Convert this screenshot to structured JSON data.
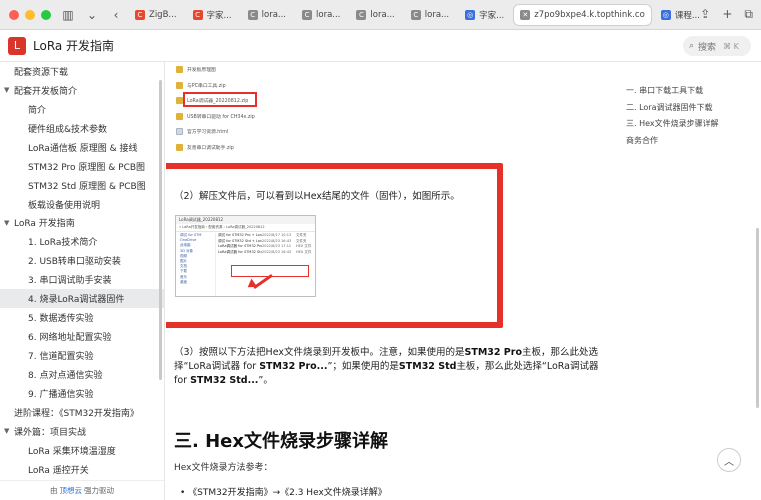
{
  "browser": {
    "tabs": [
      {
        "label": "ZigB...",
        "fav": "C",
        "color": "fav-red"
      },
      {
        "label": "字家...",
        "fav": "C",
        "color": "fav-red"
      },
      {
        "label": "lora...",
        "fav": "C",
        "color": "fav-gray"
      },
      {
        "label": "lora...",
        "fav": "C",
        "color": "fav-gray"
      },
      {
        "label": "lora...",
        "fav": "C",
        "color": "fav-gray"
      },
      {
        "label": "lora...",
        "fav": "C",
        "color": "fav-gray"
      },
      {
        "label": "字家...",
        "fav": "◎",
        "color": "fav-blue"
      },
      {
        "label": "z7po9bxpe4.k.topthink.co",
        "fav": "✕",
        "color": "fav-gray"
      },
      {
        "label": "课程...",
        "fav": "◎",
        "color": "fav-blue"
      }
    ]
  },
  "header": {
    "logo_letter": "L",
    "title": "LoRa 开发指南",
    "search_label": "搜索",
    "search_shortcut": "⌘ K"
  },
  "sidebar": {
    "items": [
      {
        "label": "配套资源下载",
        "caret": ""
      },
      {
        "label": "配套开发板简介",
        "caret": "▼"
      },
      {
        "label": "简介",
        "caret": " "
      },
      {
        "label": "硬件组成&技术参数",
        "caret": " "
      },
      {
        "label": "LoRa通信板 原理图 & 接线",
        "caret": " "
      },
      {
        "label": "STM32 Pro 原理图 & PCB图",
        "caret": " "
      },
      {
        "label": "STM32 Std 原理图 & PCB图",
        "caret": " "
      },
      {
        "label": "板载设备使用说明",
        "caret": " "
      },
      {
        "label": "LoRa 开发指南",
        "caret": "▼"
      },
      {
        "label": "1. LoRa技术简介",
        "caret": " "
      },
      {
        "label": "2. USB转串口驱动安装",
        "caret": " "
      },
      {
        "label": "3. 串口调试助手安装",
        "caret": " "
      },
      {
        "label": "4. 烧录LoRa调试器固件",
        "caret": " "
      },
      {
        "label": "5. 数据透传实验",
        "caret": " "
      },
      {
        "label": "6. 网络地址配置实验",
        "caret": " "
      },
      {
        "label": "7. 信道配置实验",
        "caret": " "
      },
      {
        "label": "8. 点对点通信实验",
        "caret": " "
      },
      {
        "label": "9. 广播通信实验",
        "caret": " "
      },
      {
        "label": "进阶课程：《STM32开发指南》",
        "caret": ""
      },
      {
        "label": "课外篇：项目实战",
        "caret": "▼"
      },
      {
        "label": "LoRa 采集环境温湿度",
        "caret": " "
      },
      {
        "label": "LoRa 遥控开关",
        "caret": " "
      }
    ],
    "footer_prefix": "由",
    "footer_brand": "顶想云",
    "footer_suffix": "强力驱动"
  },
  "content": {
    "files": [
      {
        "name": "开发板原理图",
        "kind": "fi-zip"
      },
      {
        "name": "与PC串口工具.zip",
        "kind": "fi-zip"
      },
      {
        "name": "LoRa调试器_20220812.zip",
        "kind": "fi-zip"
      },
      {
        "name": "USB转串口驱动 for CH34x.zip",
        "kind": "fi-zip"
      },
      {
        "name": "官方学习资源.html",
        "kind": "fi-doc"
      },
      {
        "name": "友善串口调试助手.zip",
        "kind": "fi-zip"
      }
    ],
    "step2": "（2）解压文件后，可以看到以Hex结尾的文件（固件），如图所示。",
    "explorer": {
      "title": "LoRa调试器_20220812",
      "address": "« LoRa开发指南 › 配套资源 › LoRa调试器_20220812",
      "nav": [
        "调试 for STM",
        "OneDrive",
        "此电脑",
        "3D 对象",
        "视频",
        "图片",
        "文档",
        "下载",
        "音乐",
        "桌面"
      ],
      "rows": [
        {
          "name": "调试 for STM32 Pro + Lora",
          "date": "2022/8/17 10:13",
          "type": "文件夹"
        },
        {
          "name": "调试 for STM32 Std + Lora",
          "date": "2022/8/23 16:43",
          "type": "文件夹"
        },
        {
          "name": "LoRa调试器 for STM32 Pro v1.2.hex",
          "date": "2022/8/23 17:11",
          "type": "HEX 文件"
        },
        {
          "name": "LoRa调试器 for STM32 Std v1.2.hex",
          "date": "2022/8/23 16:43",
          "type": "HEX 文件"
        }
      ]
    },
    "para3": {
      "p1": "（3）按照以下方法把Hex文件烧录到开发板中。注意，如果使用的是",
      "b1": "STM32 Pro",
      "p2": "主板，那么此处选择“LoRa调试器 for ",
      "b2": "STM32 Pro...",
      "p3": "”；如果使用的是",
      "b3": "STM32 Std",
      "p4": "主板，那么此处选择“LoRa调试器 for ",
      "b4": "STM32 Std...",
      "p5": "”。"
    },
    "heading": "三. Hex文件烧录步骤详解",
    "method": "Hex文件烧录方法参考：",
    "bullet": "•  《STM32开发指南》→《2.3 Hex文件烧录详解》"
  },
  "toc": {
    "items": [
      "一. 串口下载工具下载",
      "二. Lora调试器固件下载",
      "三. Hex文件烧录步骤详解",
      "商务合作"
    ]
  }
}
